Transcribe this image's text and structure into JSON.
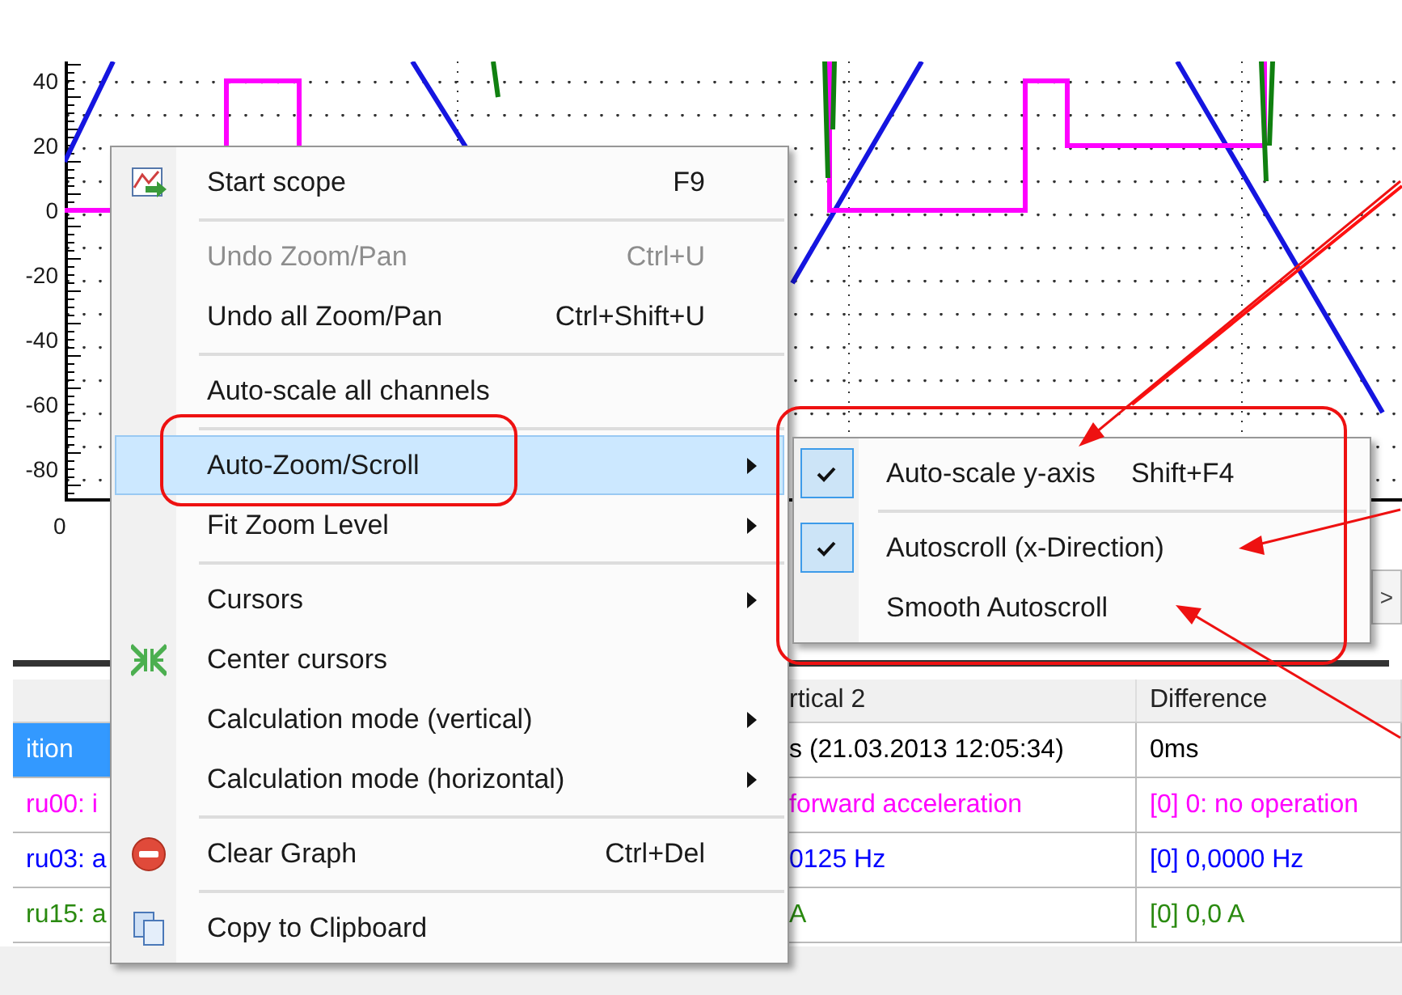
{
  "chart": {
    "y_tick_labels": [
      "40",
      "20",
      "0",
      "-20",
      "-40",
      "-60",
      "-80"
    ],
    "x_tick_labels": [
      "0"
    ]
  },
  "scroll_button": {
    "label": ">"
  },
  "table": {
    "columns": [
      "",
      "rtical 2",
      "Difference"
    ],
    "rows": [
      {
        "cells": [
          "ition",
          "s (21.03.2013 12:05:34)",
          "0ms"
        ],
        "color": "#000000",
        "selected": true
      },
      {
        "cells": [
          "ru00: i",
          "forward acceleration",
          "[0] 0: no operation"
        ],
        "color": "#ff00ff",
        "selected": false
      },
      {
        "cells": [
          "ru03: a",
          "0125 Hz",
          "[0] 0,0000 Hz"
        ],
        "color": "#0000ff",
        "selected": false
      },
      {
        "cells": [
          "ru15: a",
          "A",
          "[0] 0,0 A"
        ],
        "color": "#2a8a10",
        "selected": false
      }
    ]
  },
  "context_menu": {
    "items": [
      {
        "kind": "item",
        "label": "Start scope",
        "shortcut": "F9",
        "disabled": false,
        "selected": false,
        "submenu": false
      },
      {
        "kind": "separator"
      },
      {
        "kind": "item",
        "label": "Undo Zoom/Pan",
        "shortcut": "Ctrl+U",
        "disabled": true,
        "selected": false,
        "submenu": false
      },
      {
        "kind": "item",
        "label": "Undo all Zoom/Pan",
        "shortcut": "Ctrl+Shift+U",
        "disabled": false,
        "selected": false,
        "submenu": false
      },
      {
        "kind": "separator"
      },
      {
        "kind": "item",
        "label": "Auto-scale all channels",
        "disabled": false,
        "selected": false,
        "submenu": false
      },
      {
        "kind": "separator"
      },
      {
        "kind": "item",
        "label": "Auto-Zoom/Scroll",
        "disabled": false,
        "selected": true,
        "submenu": true
      },
      {
        "kind": "item",
        "label": "Fit Zoom Level",
        "disabled": false,
        "selected": false,
        "submenu": true
      },
      {
        "kind": "separator"
      },
      {
        "kind": "item",
        "label": "Cursors",
        "disabled": false,
        "selected": false,
        "submenu": true
      },
      {
        "kind": "item",
        "label": "Center cursors",
        "disabled": false,
        "selected": false,
        "submenu": false
      },
      {
        "kind": "item",
        "label": "Calculation mode (vertical)",
        "disabled": false,
        "selected": false,
        "submenu": true
      },
      {
        "kind": "item",
        "label": "Calculation mode (horizontal)",
        "disabled": false,
        "selected": false,
        "submenu": true
      },
      {
        "kind": "separator"
      },
      {
        "kind": "item",
        "label": "Clear Graph",
        "shortcut": "Ctrl+Del",
        "disabled": false,
        "selected": false,
        "submenu": false
      },
      {
        "kind": "separator"
      },
      {
        "kind": "item",
        "label": "Copy to Clipboard",
        "disabled": false,
        "selected": false,
        "submenu": false
      }
    ]
  },
  "submenu": {
    "items": [
      {
        "kind": "item",
        "label": "Auto-scale y-axis",
        "shortcut": "Shift+F4",
        "checked": true
      },
      {
        "kind": "separator"
      },
      {
        "kind": "item",
        "label": "Autoscroll (x-Direction)",
        "checked": true
      },
      {
        "kind": "item",
        "label": "Smooth Autoscroll",
        "checked": false
      }
    ]
  }
}
